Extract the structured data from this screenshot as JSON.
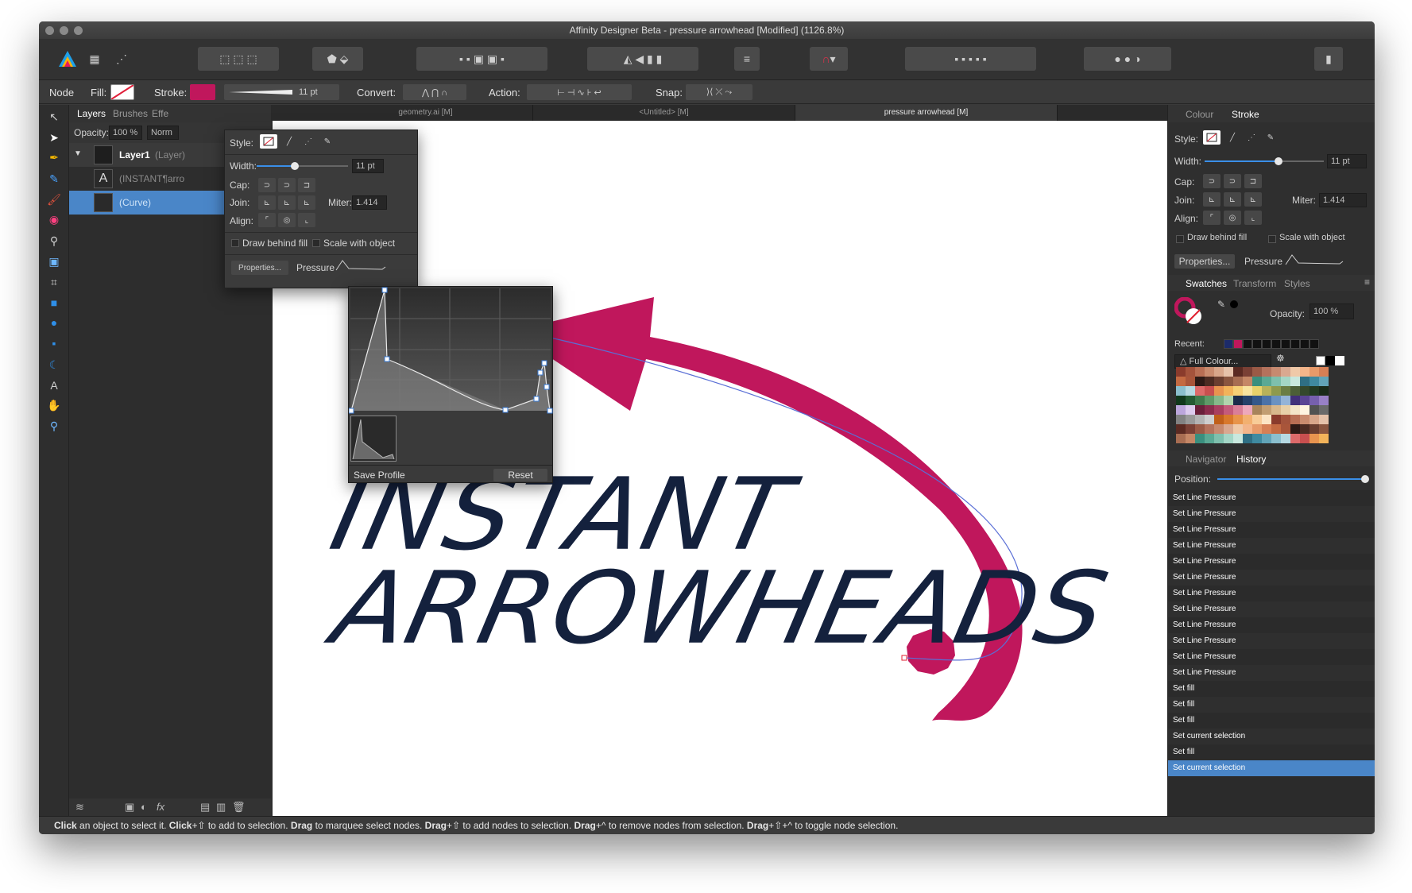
{
  "window": {
    "title": "Affinity Designer Beta - pressure arrowhead [Modified] (1126.8%)"
  },
  "context_bar": {
    "mode": "Node",
    "fill_label": "Fill:",
    "stroke_label": "Stroke:",
    "stroke_color": "#c0175c",
    "width_value": "11 pt",
    "convert_label": "Convert:",
    "action_label": "Action:",
    "snap_label": "Snap:"
  },
  "left_panel": {
    "tabs": [
      "Layers",
      "Brushes",
      "Effe"
    ],
    "opacity_label": "Opacity:",
    "opacity_value": "100 %",
    "blend_mode": "Norm",
    "layers": [
      {
        "name": "Layer1",
        "kind": "(Layer)"
      },
      {
        "name": "(INSTANT¶arro"
      },
      {
        "name": "(Curve)"
      }
    ],
    "footer_icons": [
      "layers-icon",
      "mask-icon",
      "adjustment-icon",
      "fx-icon",
      "add-layer-icon",
      "group-icon",
      "trash-icon"
    ]
  },
  "stroke_popup": {
    "style_label": "Style:",
    "width_label": "Width:",
    "width_value": "11 pt",
    "width_fraction": 0.42,
    "cap_label": "Cap:",
    "join_label": "Join:",
    "miter_label": "Miter:",
    "miter_value": "1.414",
    "align_label": "Align:",
    "draw_behind_fill": "Draw behind fill",
    "scale_with_object": "Scale with object",
    "properties_button": "Properties...",
    "pressure_label": "Pressure"
  },
  "pressure_graph": {
    "save_profile": "Save Profile",
    "reset": "Reset"
  },
  "document_tabs": [
    "geometry.ai [M]",
    "<Untitled> [M]",
    "pressure arrowhead [M]"
  ],
  "canvas": {
    "text_line1": "INSTANT",
    "text_line2": "ARROWHEADS",
    "text_color": "#14213d",
    "arrow_color": "#c0175c"
  },
  "right_panel": {
    "top_tabs": [
      "Colour",
      "Stroke"
    ],
    "style_label": "Style:",
    "width_label": "Width:",
    "width_value": "11 pt",
    "width_fraction": 0.62,
    "cap_label": "Cap:",
    "join_label": "Join:",
    "miter_label": "Miter:",
    "miter_value": "1.414",
    "align_label": "Align:",
    "draw_behind_fill": "Draw behind fill",
    "scale_with_object": "Scale with object",
    "properties_button": "Properties...",
    "pressure_label": "Pressure",
    "swatch_tabs": [
      "Swatches",
      "Transform",
      "Styles"
    ],
    "opacity_label": "Opacity:",
    "opacity_value": "100 %",
    "recent_label": "Recent:",
    "palette_name": "Full Colour...",
    "history_tabs": [
      "Navigator",
      "History"
    ],
    "position_label": "Position:",
    "history": [
      "Set Line Pressure",
      "Set Line Pressure",
      "Set Line Pressure",
      "Set Line Pressure",
      "Set Line Pressure",
      "Set Line Pressure",
      "Set Line Pressure",
      "Set Line Pressure",
      "Set Line Pressure",
      "Set Line Pressure",
      "Set Line Pressure",
      "Set Line Pressure",
      "Set fill",
      "Set fill",
      "Set fill",
      "Set current selection",
      "Set fill",
      "Set current selection"
    ]
  },
  "status": {
    "segments": [
      {
        "b": "Click"
      },
      {
        "t": " an object to select it. "
      },
      {
        "b": "Click"
      },
      {
        "t": "+⇧ to add to selection. "
      },
      {
        "b": "Drag"
      },
      {
        "t": " to marquee select nodes. "
      },
      {
        "b": "Drag"
      },
      {
        "t": "+⇧ to add nodes to selection. "
      },
      {
        "b": "Drag"
      },
      {
        "t": "+^ to remove nodes from selection. "
      },
      {
        "b": "Drag"
      },
      {
        "t": "+⇧+^ to toggle node selection."
      }
    ]
  }
}
